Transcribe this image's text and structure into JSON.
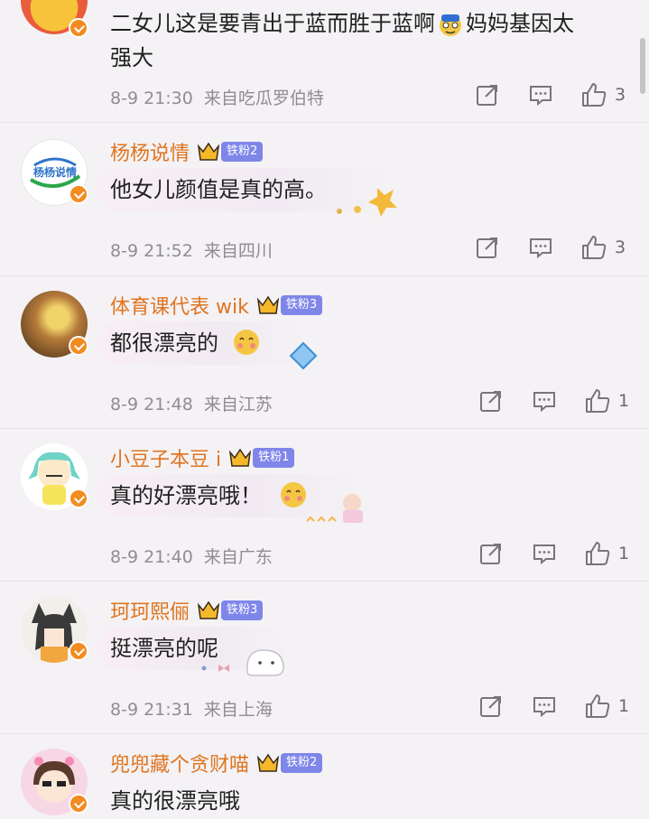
{
  "comments": [
    {
      "name": "",
      "fan_badge": "",
      "text": "二女儿这是要青出于蓝而胜于蓝啊",
      "text_cont": "妈妈基因太",
      "text_line2": "强大",
      "time": "8-9 21:30",
      "source": "来自吃瓜罗伯特",
      "likes": "3"
    },
    {
      "name": "杨杨说情",
      "fan_badge": "铁粉2",
      "avatar_label": "杨杨说情",
      "text": "他女儿颜值是真的高。",
      "time": "8-9 21:52",
      "source": "来自四川",
      "likes": "3"
    },
    {
      "name": "体育课代表 wik",
      "fan_badge": "铁粉3",
      "text": "都很漂亮的",
      "time": "8-9 21:48",
      "source": "来自江苏",
      "likes": "1"
    },
    {
      "name": "小豆子本豆 i",
      "fan_badge": "铁粉1",
      "text": "真的好漂亮哦！",
      "time": "8-9 21:40",
      "source": "来自广东",
      "likes": "1"
    },
    {
      "name": "珂珂熙俪",
      "fan_badge": "铁粉3",
      "text": "挺漂亮的呢",
      "time": "8-9 21:31",
      "source": "来自上海",
      "likes": "1"
    },
    {
      "name": "兜兜藏个贪财喵",
      "fan_badge": "铁粉2",
      "text": "真的很漂亮哦",
      "time": "",
      "source": "",
      "likes": ""
    }
  ],
  "colors": {
    "name": "#e0741f",
    "badge": "#7f86ea",
    "verified": "#f28c21",
    "background": "#f4f2f5"
  }
}
